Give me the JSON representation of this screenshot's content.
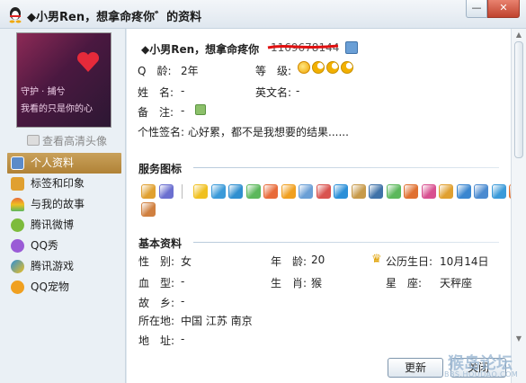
{
  "window": {
    "title": "◆小男Ren，想拿命疼你゛的资料",
    "minimize_glyph": "—",
    "close_glyph": "✕"
  },
  "avatar": {
    "text_line1": "守护 · 捕兮",
    "text_line2": "我看的只是你的心"
  },
  "sidebar": {
    "hd_avatar_link": "查看高清头像",
    "items": [
      {
        "label": "个人资料",
        "icon": "profile-card-icon",
        "color": "#5b8bc9",
        "active": true
      },
      {
        "label": "标签和印象",
        "icon": "tag-person-icon",
        "color": "#e0a030"
      },
      {
        "label": "与我的故事",
        "icon": "rainbow-icon",
        "color": "#e86b3a"
      },
      {
        "label": "腾讯微博",
        "icon": "weibo-icon",
        "color": "#7dbb3c"
      },
      {
        "label": "QQ秀",
        "icon": "qq-show-icon",
        "color": "#9a5bd6"
      },
      {
        "label": "腾讯游戏",
        "icon": "game-icon",
        "color": "#2a8fd8"
      },
      {
        "label": "QQ宠物",
        "icon": "pet-icon",
        "color": "#f0a020"
      }
    ]
  },
  "profile": {
    "nickname": "◆小男Ren，想拿命疼你",
    "qq_number": "1169678144",
    "age_label": "Q　龄:",
    "age_value": "2年",
    "level_label": "等　级:",
    "name_label": "姓　名:",
    "name_value": "-",
    "english_label": "英文名:",
    "english_value": "-",
    "memo_label": "备　注:",
    "memo_value": "-",
    "signature_label": "个性签名:",
    "signature_value": "心好累，都不是我想要的结果......"
  },
  "services": {
    "title": "服务图标",
    "icons": [
      {
        "name": "mail-bundle-icon",
        "color": "#e0a030"
      },
      {
        "name": "card-stack-icon",
        "color": "#6b6fd0"
      },
      {
        "name": "star-icon",
        "color": "#f0c020"
      },
      {
        "name": "qzone-icon",
        "color": "#3a9ad9"
      },
      {
        "name": "earth-icon",
        "color": "#2f8fd0"
      },
      {
        "name": "chat-bubble-icon",
        "color": "#5cb85c"
      },
      {
        "name": "app-icon",
        "color": "#e86b3a"
      },
      {
        "name": "wallet-icon",
        "color": "#f0a020"
      },
      {
        "name": "letter-icon",
        "color": "#6a9fd6"
      },
      {
        "name": "music-icon",
        "color": "#d9534f"
      },
      {
        "name": "ie-icon",
        "color": "#2a8fd8"
      },
      {
        "name": "camera-monkey-icon",
        "color": "#c79a4a"
      },
      {
        "name": "phone-icon",
        "color": "#3f72a8"
      },
      {
        "name": "cartoon-icon",
        "color": "#5cb85c"
      },
      {
        "name": "penguin-fire-icon",
        "color": "#e07030"
      },
      {
        "name": "girl-icon",
        "color": "#d85090"
      },
      {
        "name": "penguin-icon",
        "color": "#e0a030"
      },
      {
        "name": "mail-window-icon",
        "color": "#3a86d0"
      },
      {
        "name": "photo-icon",
        "color": "#4a8ad0"
      },
      {
        "name": "ball-icon",
        "color": "#3a9ad9"
      },
      {
        "name": "house-icon",
        "color": "#e07030"
      },
      {
        "name": "pet-monkey-icon",
        "color": "#d08040"
      }
    ]
  },
  "basic": {
    "title": "基本资料",
    "gender_label": "性　别:",
    "gender_value": "女",
    "age_label": "年　龄:",
    "age_value": "20",
    "birthday_label": "公历生日:",
    "birthday_value": "10月14日",
    "blood_label": "血　型:",
    "blood_value": "-",
    "zodiac_label": "生　肖:",
    "zodiac_value": "猴",
    "star_label": "星　座:",
    "star_value": "天秤座",
    "hometown_label": "故　乡:",
    "hometown_value": "-",
    "location_label": "所在地:",
    "location_value": "中国 江苏 南京",
    "address_label": "地　址:",
    "address_value": "-"
  },
  "buttons": {
    "refresh": "更新",
    "close": "关闭"
  },
  "watermark": {
    "main": "猴岛论坛",
    "sub": "BBS.HOUDAO.COM"
  }
}
